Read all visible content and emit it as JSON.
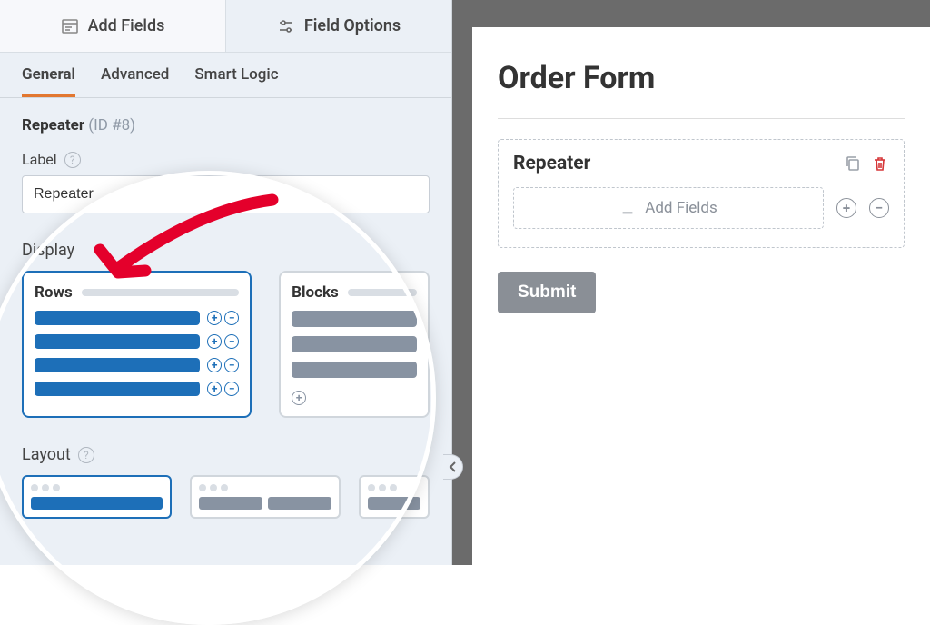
{
  "topTabs": {
    "addFields": "Add Fields",
    "fieldOptions": "Field Options"
  },
  "subTabs": {
    "general": "General",
    "advanced": "Advanced",
    "smartLogic": "Smart Logic"
  },
  "fieldHeader": {
    "name": "Repeater",
    "id": "(ID #8)"
  },
  "labelField": {
    "label": "Label",
    "value": "Repeater"
  },
  "displaySection": {
    "title": "Display",
    "rows": "Rows",
    "blocks": "Blocks"
  },
  "layoutSection": {
    "title": "Layout"
  },
  "preview": {
    "formTitle": "Order Form",
    "repeaterTitle": "Repeater",
    "addFields": "Add Fields",
    "submit": "Submit"
  }
}
